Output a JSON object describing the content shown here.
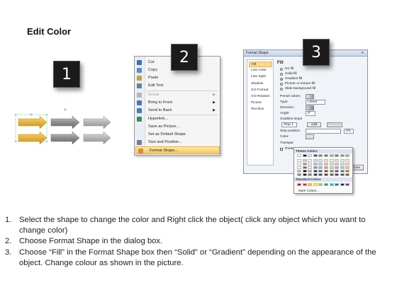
{
  "title": "Edit Color",
  "steps": [
    "1",
    "2",
    "3"
  ],
  "context_menu": {
    "items": [
      {
        "label": "Cut",
        "icon": "scissors-icon",
        "color": "#3a6fc0"
      },
      {
        "label": "Copy",
        "icon": "copy-icon",
        "color": "#5a8bd0"
      },
      {
        "label": "Paste",
        "icon": "paste-icon",
        "color": "#c9a23c"
      },
      {
        "label": "Edit Text",
        "icon": "edit-text-icon",
        "color": "#6b7f9a"
      },
      {
        "label": "Group",
        "icon": "group-icon",
        "color": "#b8b8b8",
        "disabled": true,
        "submenu": true
      },
      {
        "label": "Bring to Front",
        "icon": "bring-front-icon",
        "color": "#4a79b8",
        "submenu": true
      },
      {
        "label": "Send to Back",
        "icon": "send-back-icon",
        "color": "#4a79b8",
        "submenu": true
      },
      {
        "label": "Hyperlink...",
        "icon": "hyperlink-icon",
        "color": "#3f8c4a"
      },
      {
        "label": "Save as Picture...",
        "icon": "",
        "color": ""
      },
      {
        "label": "Set as Default Shape",
        "icon": "",
        "color": ""
      },
      {
        "label": "Size and Position...",
        "icon": "size-icon",
        "color": "#6b7f9a"
      },
      {
        "label": "Format Shape...",
        "icon": "format-shape-icon",
        "color": "#d9893a",
        "highlight": true
      }
    ]
  },
  "format_dialog": {
    "title": "Format Shape",
    "close": "✕",
    "nav": [
      "Fill",
      "Line Color",
      "Line Style",
      "Shadow",
      "3-D Format",
      "3-D Rotation",
      "Picture",
      "Text Box"
    ],
    "section": "Fill",
    "options": [
      "No fill",
      "Solid fill",
      "Gradient fill",
      "Picture or texture fill",
      "Slide background fill"
    ],
    "selected_option": "Gradient fill",
    "preset_colors": "Preset colors:",
    "type_label": "Type:",
    "type_value": "Linear",
    "direction_label": "Direction:",
    "angle_label": "Angle:",
    "angle_value": "0°",
    "gradient_stops": "Gradient stops",
    "stop_value": "Stop 1",
    "add": "Add",
    "remove": "Remove",
    "stop_position_label": "Stop position:",
    "stop_position_value": "0%",
    "color_label": "Color:",
    "transparency_label": "Transpar",
    "rotate_label": "Rotate",
    "close_button": "Close"
  },
  "color_palette": {
    "theme_header": "Theme Colors",
    "standard_header": "Standard Colors",
    "more": "More Colors...",
    "theme_top": [
      "#ffffff",
      "#000000",
      "#eeece1",
      "#1f497d",
      "#4f81bd",
      "#c0504d",
      "#9bbb59",
      "#8064a2",
      "#4bacc6",
      "#f79646"
    ],
    "standard": [
      "#c00000",
      "#ff0000",
      "#ffc000",
      "#ffff00",
      "#92d050",
      "#00b050",
      "#00b0f0",
      "#0070c0",
      "#002060",
      "#7030a0"
    ]
  },
  "instructions": [
    {
      "num": "1.",
      "text": "Select the shape to change the color and Right click the object( click any object which you want to change color)"
    },
    {
      "num": "2.",
      "text": "Choose Format Shape in the dialog box."
    },
    {
      "num": "3.",
      "text": "Choose “Fill” in the Format Shape box then “Solid” or “Gradient” depending on the appearance of the object. Change colour as shown in the picture."
    }
  ]
}
